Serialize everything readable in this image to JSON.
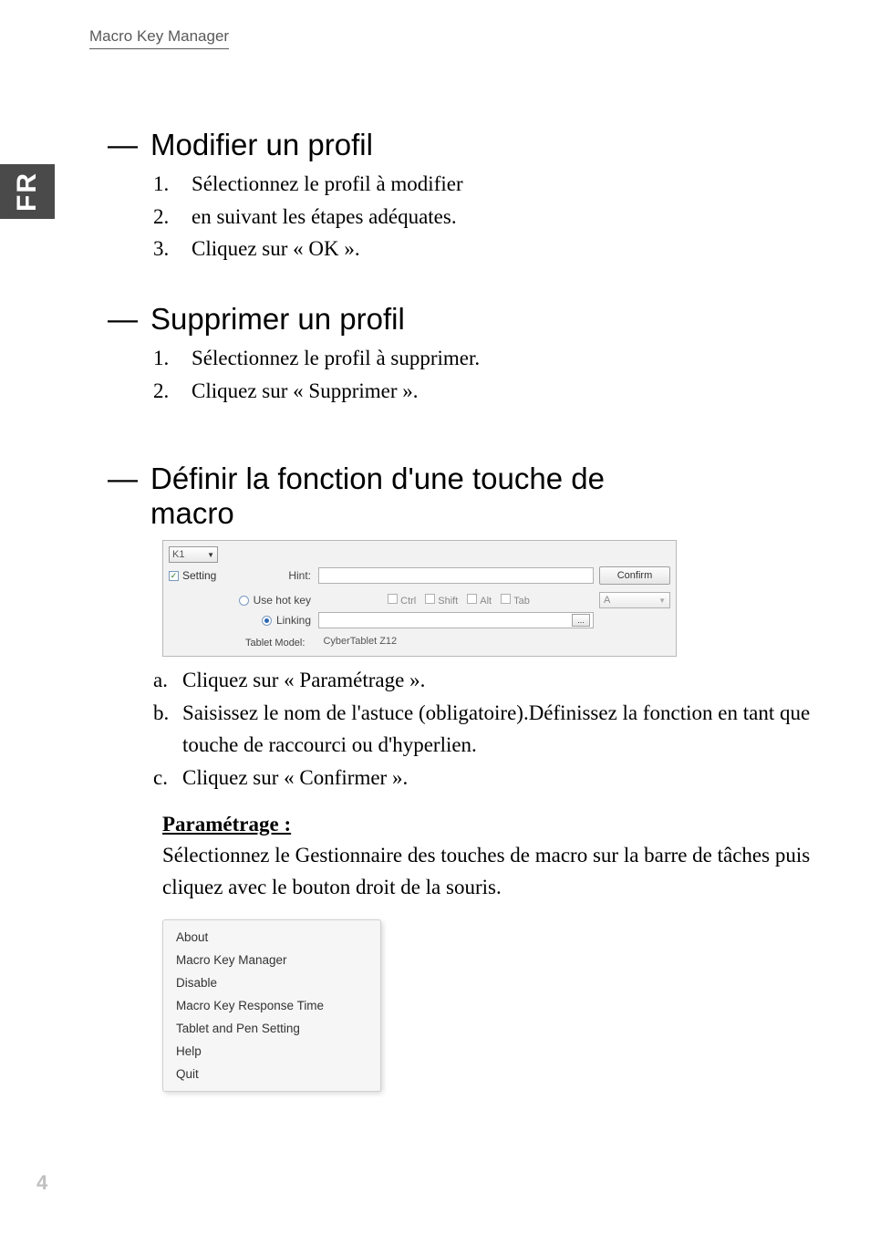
{
  "header": {
    "title": "Macro Key Manager"
  },
  "side_tab": "FR",
  "page_number": "4",
  "sections": {
    "modify": {
      "heading_dash": "—",
      "heading": "Modifier un profil",
      "steps": [
        {
          "num": "1.",
          "text": "Sélectionnez le profil à modifier"
        },
        {
          "num": "2.",
          "text": "en suivant les étapes adéquates."
        },
        {
          "num": "3.",
          "text": "Cliquez sur « OK »."
        }
      ]
    },
    "delete": {
      "heading_dash": "—",
      "heading": "Supprimer un profil",
      "steps": [
        {
          "num": "1.",
          "text": "Sélectionnez le profil à supprimer."
        },
        {
          "num": "2.",
          "text": "Cliquez sur « Supprimer »."
        }
      ]
    },
    "define": {
      "heading_dash": "—",
      "heading_line1": "Définir la fonction d'une touche de",
      "heading_line2": "macro",
      "screenshot": {
        "dropdown_value": "K1",
        "setting_checked": "✓",
        "setting_label": "Setting",
        "hint_label": "Hint:",
        "confirm_label": "Confirm",
        "hotkey_label": "Use hot key",
        "linking_label": "Linking",
        "ctrl": "Ctrl",
        "shift": "Shift",
        "alt": "Alt",
        "tab": "Tab",
        "key_value": "A",
        "browse": "...",
        "tablet_model_label": "Tablet Model:",
        "tablet_model_value": "CyberTablet Z12"
      },
      "substeps": [
        {
          "num": "a.",
          "text": "Cliquez sur « Paramétrage »."
        },
        {
          "num": "b.",
          "text": "Saisissez le nom de l'astuce (obligatoire).Définissez la fonction en tant que touche de raccourci ou d'hyperlien."
        },
        {
          "num": "c.",
          "text": "Cliquez sur « Confirmer »."
        }
      ],
      "param_title": "Paramétrage :",
      "param_text": "Sélectionnez le Gestionnaire des touches de macro sur la barre de tâches puis cliquez avec le bouton droit de la souris.",
      "menu": [
        "About",
        "Macro Key Manager",
        "Disable",
        "Macro Key Response Time",
        "Tablet and Pen Setting",
        "Help",
        "Quit"
      ]
    }
  }
}
